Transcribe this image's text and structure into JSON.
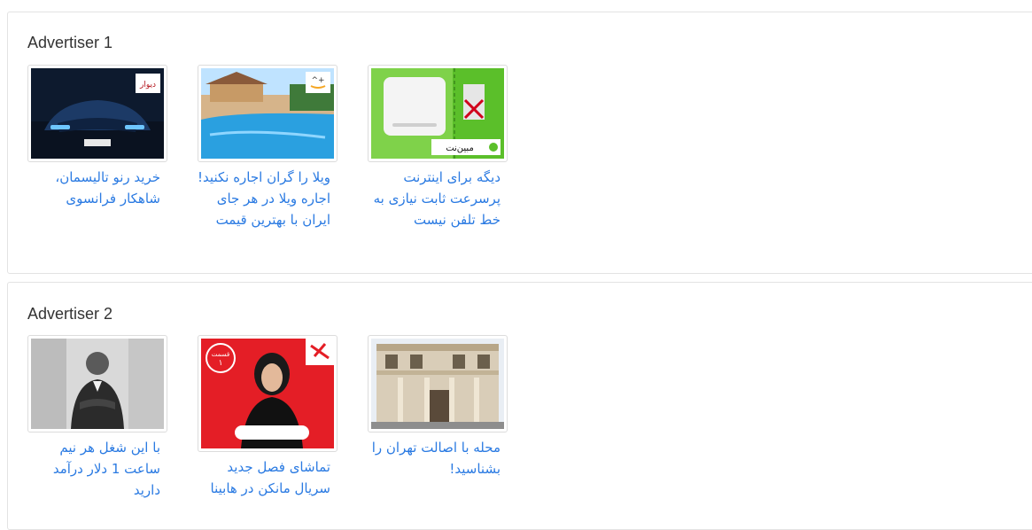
{
  "advertisers": [
    {
      "title": "Advertiser 1",
      "ads": [
        {
          "caption": "خرید رنو تالیسمان، شاهکار فرانسوی",
          "badge": "دیوار",
          "image": "car-ad-image"
        },
        {
          "caption": "ویلا را گران اجاره نکنید! اجاره ویلا در هر جای ایران با بهترین قیمت",
          "badge": "^+",
          "image": "villa-pool-ad-image"
        },
        {
          "caption": "دیگه برای اینترنت پرسرعت ثابت نیازی به خط تلفن نیست",
          "badge": "مبین‌نت",
          "image": "modem-ad-image"
        }
      ]
    },
    {
      "title": "Advertiser 2",
      "ads": [
        {
          "caption": "با این شغل هر نیم ساعت 1 دلار درآمد دارید",
          "image": "businessman-ad-image"
        },
        {
          "caption": "تماشای فصل جدید سریال مانکن در هابینا",
          "badge": "قسمت ۱",
          "image": "series-ad-image"
        },
        {
          "caption": "محله با اصالت تهران را بشناسید!",
          "image": "building-ad-image"
        }
      ]
    }
  ],
  "colors": {
    "link": "#2a7ae2",
    "border": "#e3e3e3"
  }
}
